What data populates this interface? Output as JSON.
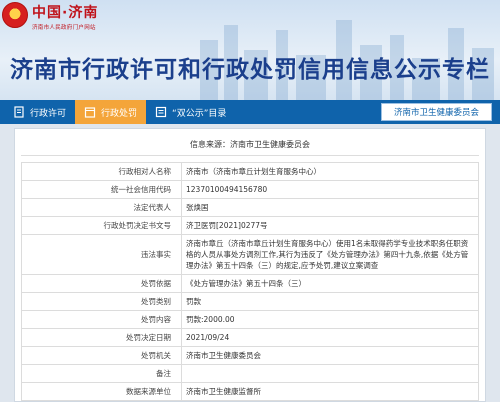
{
  "header": {
    "logo_title": "中国·济南",
    "logo_sub": "济南市人民政府门户网站",
    "page_title": "济南市行政许可和行政处罚信用信息公示专栏"
  },
  "nav": {
    "items": [
      {
        "label": "行政许可"
      },
      {
        "label": "行政处罚"
      },
      {
        "label": "“双公示”目录"
      }
    ],
    "department": "济南市卫生健康委员会"
  },
  "detail": {
    "source": "信息来源：济南市卫生健康委员会",
    "rows": [
      {
        "key": "行政相对人名称",
        "value": "济南市（济南市章丘计划生育服务中心）"
      },
      {
        "key": "统一社会信用代码",
        "value": "12370100494156780"
      },
      {
        "key": "法定代表人",
        "value": "张焕国"
      },
      {
        "key": "行政处罚决定书文号",
        "value": "济卫医罚[2021]0277号"
      },
      {
        "key": "违法事实",
        "value": "济南市章丘（济南市章丘计划生育服务中心）使用1名未取得药学专业技术职务任职资格的人员从事处方调剂工作,其行为违反了《处方管理办法》第四十九条,依据《处方管理办法》第五十四条（三）的规定,应予处罚,建议立案调查"
      },
      {
        "key": "处罚依据",
        "value": "《处方管理办法》第五十四条（三）"
      },
      {
        "key": "处罚类别",
        "value": "罚款"
      },
      {
        "key": "处罚内容",
        "value": "罚款:2000.00"
      },
      {
        "key": "处罚决定日期",
        "value": "2021/09/24"
      },
      {
        "key": "处罚机关",
        "value": "济南市卫生健康委员会"
      },
      {
        "key": "备注",
        "value": ""
      },
      {
        "key": "数据来源单位",
        "value": "济南市卫生健康监督所"
      }
    ]
  },
  "colors": {
    "nav_bg": "#0f63ab",
    "nav_active": "#f4a53a",
    "title": "#1b3f8c",
    "logo_red": "#c0121a"
  }
}
